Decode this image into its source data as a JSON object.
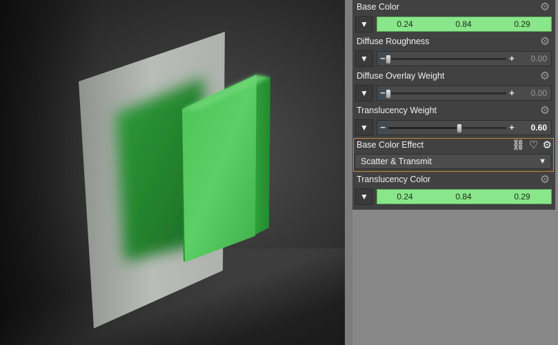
{
  "panel": {
    "properties": [
      {
        "title": "Base Color",
        "kind": "color",
        "values": [
          "0.24",
          "0.84",
          "0.29"
        ]
      },
      {
        "title": "Diffuse Roughness",
        "kind": "slider",
        "value": "0.00",
        "fraction": 0.0
      },
      {
        "title": "Diffuse Overlay Weight",
        "kind": "slider",
        "value": "0.00",
        "fraction": 0.0
      },
      {
        "title": "Translucency Weight",
        "kind": "slider",
        "value": "0.60",
        "fraction": 0.6
      },
      {
        "title": "Base Color Effect",
        "kind": "dropdown",
        "selected": "Scatter & Transmit",
        "icons": [
          "link-icon",
          "heart-icon",
          "gear-icon"
        ]
      },
      {
        "title": "Translucency Color",
        "kind": "color",
        "values": [
          "0.24",
          "0.84",
          "0.29"
        ]
      }
    ],
    "colors": {
      "color_field": "#8ae68a",
      "highlight_border": "#c08a3a",
      "panel_bg": "#414141"
    }
  },
  "icons": {
    "dropdown_arrow": "▼",
    "gear": "⚙",
    "minus": "−",
    "plus": "+",
    "link": "⛓",
    "heart": "♡"
  }
}
